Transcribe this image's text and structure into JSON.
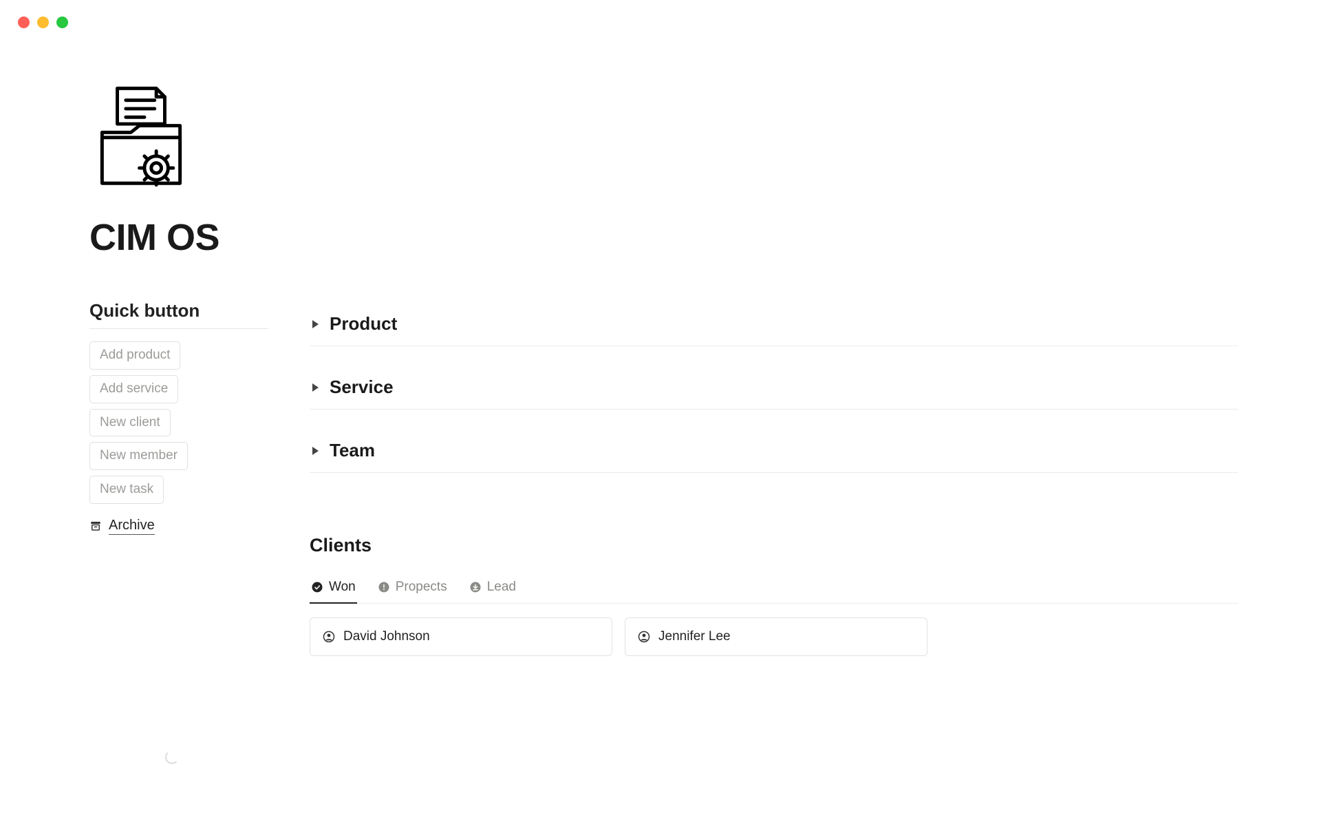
{
  "page_title": "CIM OS",
  "quick_button": {
    "title": "Quick button",
    "buttons": [
      "Add product",
      "Add service",
      "New client",
      "New member",
      "New task"
    ]
  },
  "archive": {
    "label": "Archive"
  },
  "toggles": [
    {
      "label": "Product"
    },
    {
      "label": "Service"
    },
    {
      "label": "Team"
    }
  ],
  "clients": {
    "title": "Clients",
    "tabs": [
      {
        "label": "Won",
        "active": true,
        "icon": "check-circle"
      },
      {
        "label": "Propects",
        "active": false,
        "icon": "alert-circle"
      },
      {
        "label": "Lead",
        "active": false,
        "icon": "download-circle"
      }
    ],
    "cards": [
      {
        "name": "David Johnson"
      },
      {
        "name": "Jennifer Lee"
      }
    ]
  }
}
